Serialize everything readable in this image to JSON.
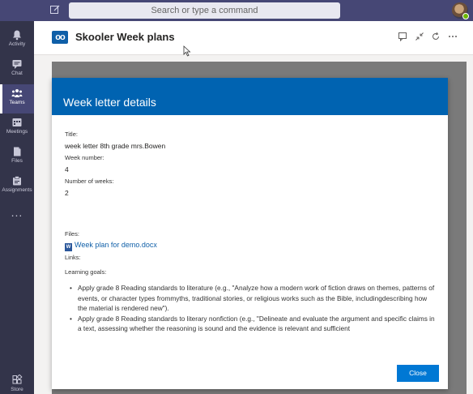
{
  "topbar": {
    "search_placeholder": "Search or type a command",
    "compose_icon": "compose-icon",
    "avatar_icon": "user-avatar"
  },
  "rail": {
    "items": [
      {
        "label": "Activity",
        "icon": "bell-icon"
      },
      {
        "label": "Chat",
        "icon": "chat-icon"
      },
      {
        "label": "Teams",
        "icon": "teams-icon",
        "active": true
      },
      {
        "label": "Meetings",
        "icon": "calendar-icon"
      },
      {
        "label": "Files",
        "icon": "file-icon"
      },
      {
        "label": "Assignments",
        "icon": "assignments-icon"
      }
    ],
    "more": "...",
    "store_label": "Store"
  },
  "app": {
    "title": "Skooler Week plans",
    "logo_text": "oo"
  },
  "dialog": {
    "header": "Week letter details",
    "title_label": "Title:",
    "title_value": "week letter 8th grade mrs.Bowen",
    "week_number_label": "Week number:",
    "week_number_value": "4",
    "num_weeks_label": "Number of weeks:",
    "num_weeks_value": "2",
    "files_label": "Files:",
    "file_name": "Week plan for demo.docx",
    "links_label": "Links:",
    "learning_goals_label": "Learning goals:",
    "goals": [
      "Apply grade 8 Reading standards to literature (e.g., \"Analyze how a modern work of fiction draws on themes, patterns of events, or character types frommyths, traditional stories, or religious works such as the Bible, includingdescribing how the material is rendered new\").",
      "Apply grade 8 Reading standards to literary nonfiction (e.g., \"Delineate and evaluate the argument and specific claims in a text, assessing whether the reasoning is sound and the evidence is relevant and sufficient"
    ],
    "close_label": "Close"
  },
  "colors": {
    "topbar": "#464775",
    "rail": "#33344a",
    "dialog_header": "#0063b1",
    "button": "#0078d4"
  }
}
